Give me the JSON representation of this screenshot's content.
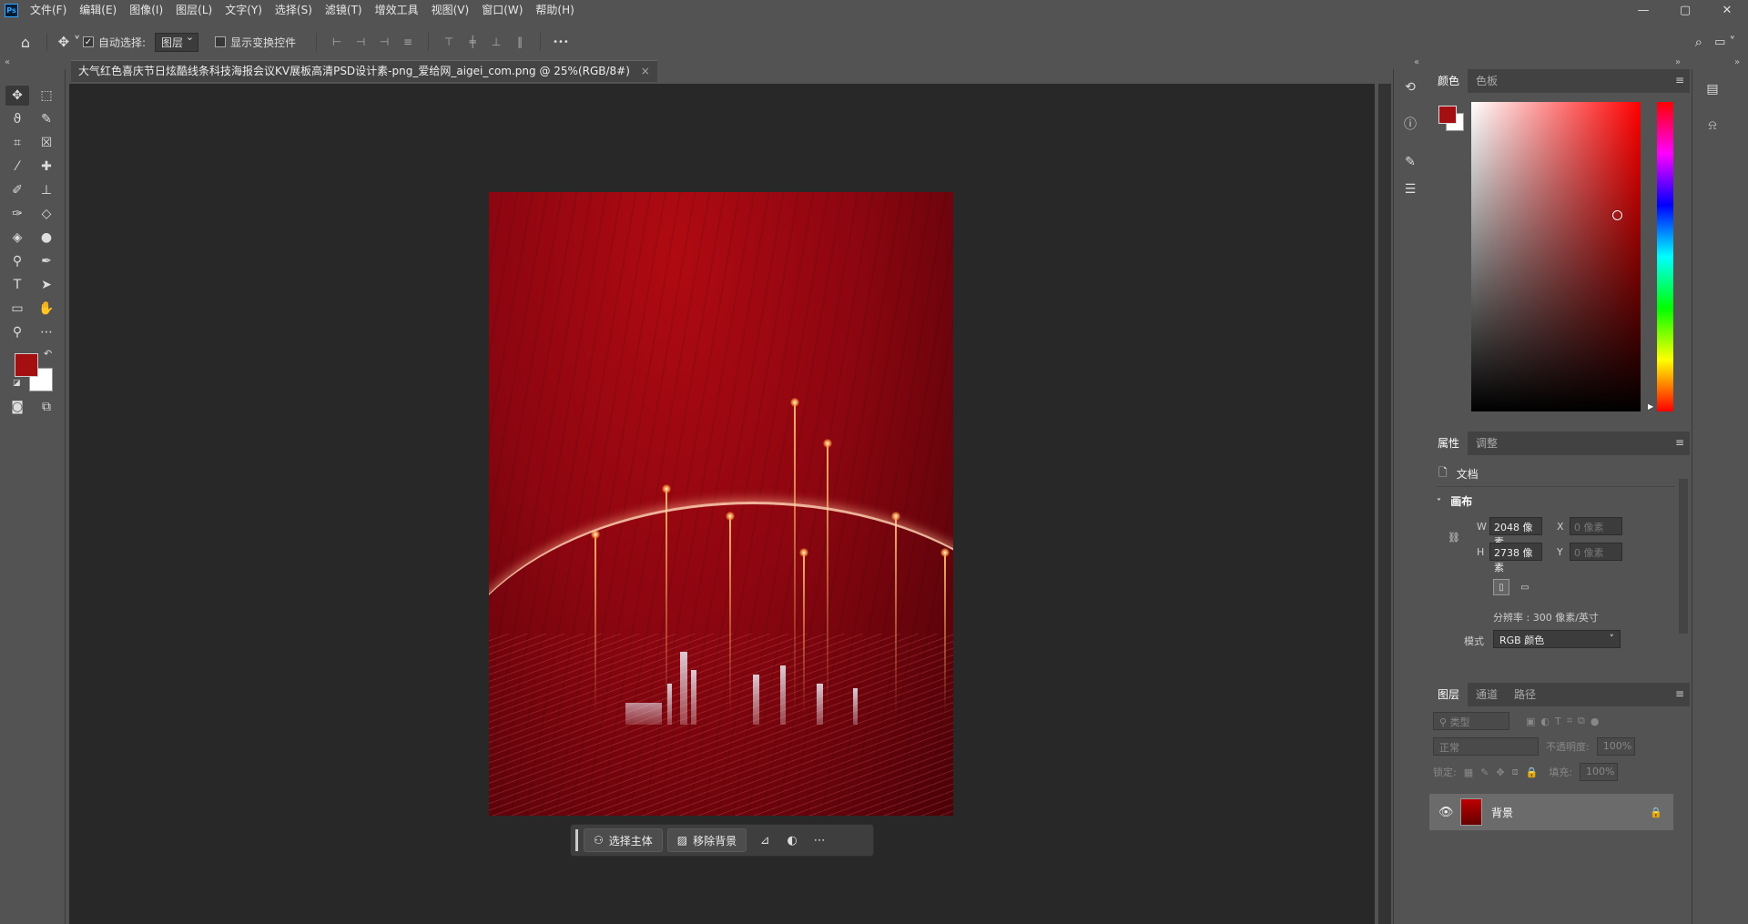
{
  "app": {
    "logo_text": "Ps"
  },
  "menus": [
    "文件(F)",
    "编辑(E)",
    "图像(I)",
    "图层(L)",
    "文字(Y)",
    "选择(S)",
    "滤镜(T)",
    "增效工具",
    "视图(V)",
    "窗口(W)",
    "帮助(H)"
  ],
  "window_controls": [
    "—",
    "▢",
    "✕"
  ],
  "options": {
    "auto_select_label": "自动选择:",
    "auto_select_checked": "✓",
    "auto_select_target": "图层",
    "transform_controls_label": "显示变换控件",
    "more": "•••"
  },
  "document": {
    "tab_title": "大气红色喜庆节日炫酷线条科技海报会议KV展板高清PSD设计素-png_爱给网_aigei_com.png @ 25%(RGB/8#)",
    "tab_close": "×"
  },
  "contextual_bar": {
    "select_subject": "选择主体",
    "remove_background": "移除背景"
  },
  "color_panel": {
    "tabs": [
      "颜色",
      "色板"
    ],
    "foreground": "#a40f12",
    "background": "#ffffff"
  },
  "properties_panel": {
    "tabs": [
      "属性",
      "调整"
    ],
    "doc_label": "文档",
    "canvas_section": "画布",
    "w_label": "W",
    "w_value": "2048 像素",
    "h_label": "H",
    "h_value": "2738 像素",
    "x_label": "X",
    "x_placeholder": "0 像素",
    "y_label": "Y",
    "y_placeholder": "0 像素",
    "resolution": "分辨率 : 300 像素/英寸",
    "mode_label": "模式",
    "mode_value": "RGB 颜色"
  },
  "layers_panel": {
    "tabs": [
      "图层",
      "通道",
      "路径"
    ],
    "filter_placeholder": "类型",
    "blend_mode": "正常",
    "opacity_label": "不透明度:",
    "opacity_value": "100%",
    "lock_label": "锁定:",
    "fill_label": "填充:",
    "fill_value": "100%",
    "layer_name": "背景"
  }
}
